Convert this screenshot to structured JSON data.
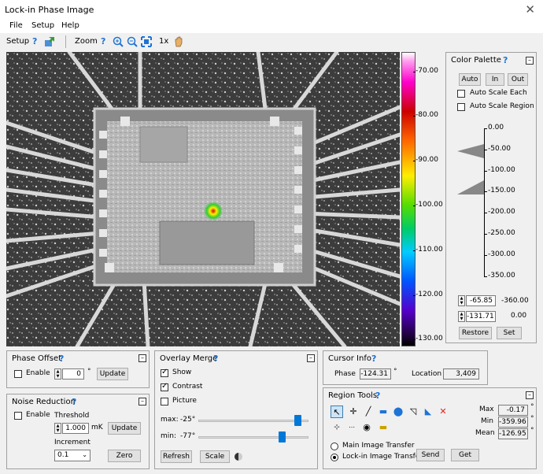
{
  "window": {
    "title": "Lock-in Phase Image",
    "close": "✕"
  },
  "menu": [
    "File",
    "Setup",
    "Help"
  ],
  "toolbar": {
    "setup": "Setup",
    "zoom": "Zoom",
    "zoom_level": "1x",
    "help": "?"
  },
  "colorbar": {
    "ticks": [
      "-70.00",
      "-80.00",
      "-90.00",
      "-100.00",
      "-110.00",
      "-120.00",
      "-130.00"
    ]
  },
  "color_palette": {
    "title": "Color Palette",
    "auto": "Auto",
    "in": "In",
    "out": "Out",
    "auto_scale_each": "Auto Scale Each",
    "auto_scale_region": "Auto Scale Region",
    "scale": [
      "0.00",
      "-50.00",
      "-100.00",
      "-150.00",
      "-200.00",
      "-250.00",
      "-300.00",
      "-350.00"
    ],
    "upper_value": "-65.85",
    "lower_value": "-131.71",
    "upper_max": "-360.00",
    "lower_min": "0.00",
    "restore": "Restore",
    "set": "Set",
    "minimize": "–"
  },
  "phase_offset": {
    "title": "Phase Offset",
    "enable": "Enable",
    "value": "0",
    "unit": "°",
    "update": "Update"
  },
  "noise_reduction": {
    "title": "Noise Reduction",
    "enable": "Enable",
    "threshold_label": "Threshold",
    "threshold": "1.000",
    "unit": "mK",
    "update": "Update",
    "increment_label": "Increment",
    "increment": "0.1",
    "zero": "Zero"
  },
  "overlay_merge": {
    "title": "Overlay Merge",
    "show": "Show",
    "contrast": "Contrast",
    "picture": "Picture",
    "max_label": "max:",
    "max_value": "-25°",
    "min_label": "min:",
    "min_value": "-77°",
    "max_level": 0.93,
    "min_level": 0.78,
    "refresh": "Refresh",
    "scale": "Scale"
  },
  "cursor_info": {
    "title": "Cursor Info",
    "phase_label": "Phase",
    "phase": "-124.31",
    "unit": "°",
    "location_label": "Location",
    "location": "3,409"
  },
  "region_tools": {
    "title": "Region Tools",
    "max_label": "Max",
    "max": "-0.17",
    "min_label": "Min",
    "min": "-359.96",
    "mean_label": "Mean",
    "mean": "-126.95",
    "unit": "°",
    "main_transfer": "Main Image Transfer",
    "lockin_transfer": "Lock-in Image Transfer",
    "send": "Send",
    "get": "Get"
  }
}
